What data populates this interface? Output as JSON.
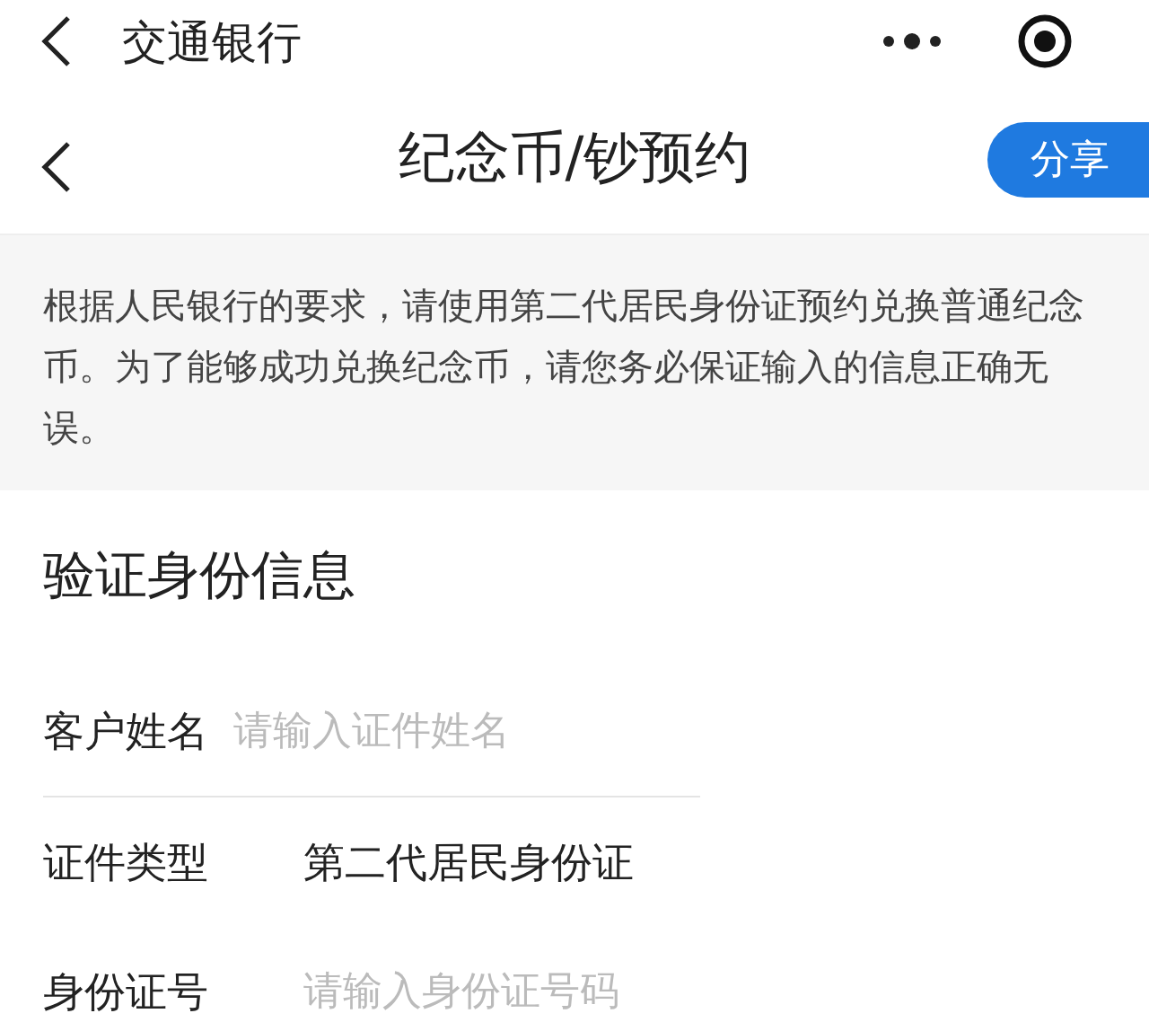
{
  "mini_program_bar": {
    "title": "交通银行"
  },
  "header": {
    "title": "纪念币/钞预约",
    "share_button": "分享"
  },
  "notice": "根据人民银行的要求，请使用第二代居民身份证预约兑换普通纪念币。为了能够成功兑换纪念币，请您务必保证输入的信息正确无误。",
  "form": {
    "title": "验证身份信息",
    "fields": [
      {
        "kind": "input",
        "label": "客户姓名",
        "placeholder": "请输入证件姓名"
      },
      {
        "kind": "value",
        "label": "证件类型",
        "value": "第二代居民身份证"
      },
      {
        "kind": "input",
        "label": "身份证号",
        "placeholder": "请输入身份证号码"
      }
    ]
  }
}
